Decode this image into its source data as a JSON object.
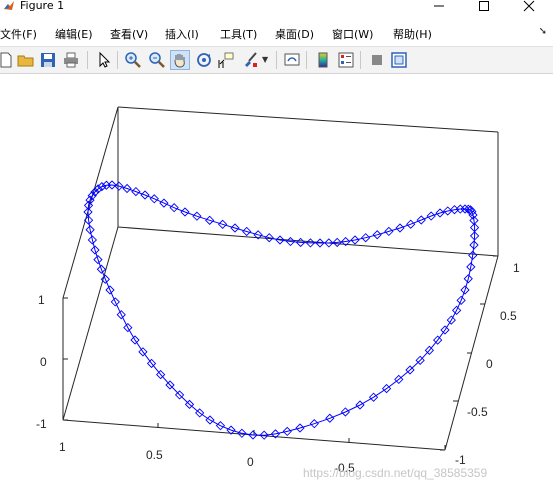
{
  "window": {
    "title": "Figure 1"
  },
  "menu": [
    {
      "label": "文件",
      "key": "(F)"
    },
    {
      "label": "编辑",
      "key": "(E)"
    },
    {
      "label": "查看",
      "key": "(V)"
    },
    {
      "label": "插入",
      "key": "(I)"
    },
    {
      "label": "工具",
      "key": "(T)"
    },
    {
      "label": "桌面",
      "key": "(D)"
    },
    {
      "label": "窗口",
      "key": "(W)"
    },
    {
      "label": "帮助",
      "key": "(H)"
    }
  ],
  "toolbar": {
    "icons": [
      "new-figure-icon",
      "open-file-icon",
      "save-icon",
      "print-icon",
      "pointer-icon",
      "zoom-in-icon",
      "zoom-out-icon",
      "pan-hand-icon",
      "rotate-3d-icon",
      "data-cursor-icon",
      "brush-icon",
      "link-plot-icon",
      "colorbar-icon",
      "legend-icon",
      "hide-plot-tools-icon",
      "show-plot-tools-icon"
    ],
    "active": "pan-hand-icon",
    "accent": "#8fb4de"
  },
  "axes": {
    "z_ticks": [
      "1",
      "0",
      "-1"
    ],
    "x_ticks": [
      "1",
      "0.5",
      "0",
      "-0.5",
      "-1"
    ],
    "y_ticks": [
      "1",
      "0.5",
      "0",
      "-0.5",
      "-1"
    ]
  },
  "chart_data": {
    "type": "line",
    "plot": "plot3",
    "marker": "diamond",
    "color": "#0000ff",
    "title": "",
    "xlabel": "",
    "ylabel": "",
    "zlabel": "",
    "xlim": [
      -1,
      1
    ],
    "ylim": [
      -1,
      1
    ],
    "zlim": [
      -1,
      1
    ],
    "grid": false,
    "x_ticks": [
      1,
      0.5,
      0,
      -0.5,
      -1
    ],
    "y_ticks": [
      1,
      0.5,
      0,
      -0.5,
      -1
    ],
    "z_ticks": [
      1,
      0,
      -1
    ]
  },
  "watermark": "https://blog.csdn.net/qq_38585359"
}
